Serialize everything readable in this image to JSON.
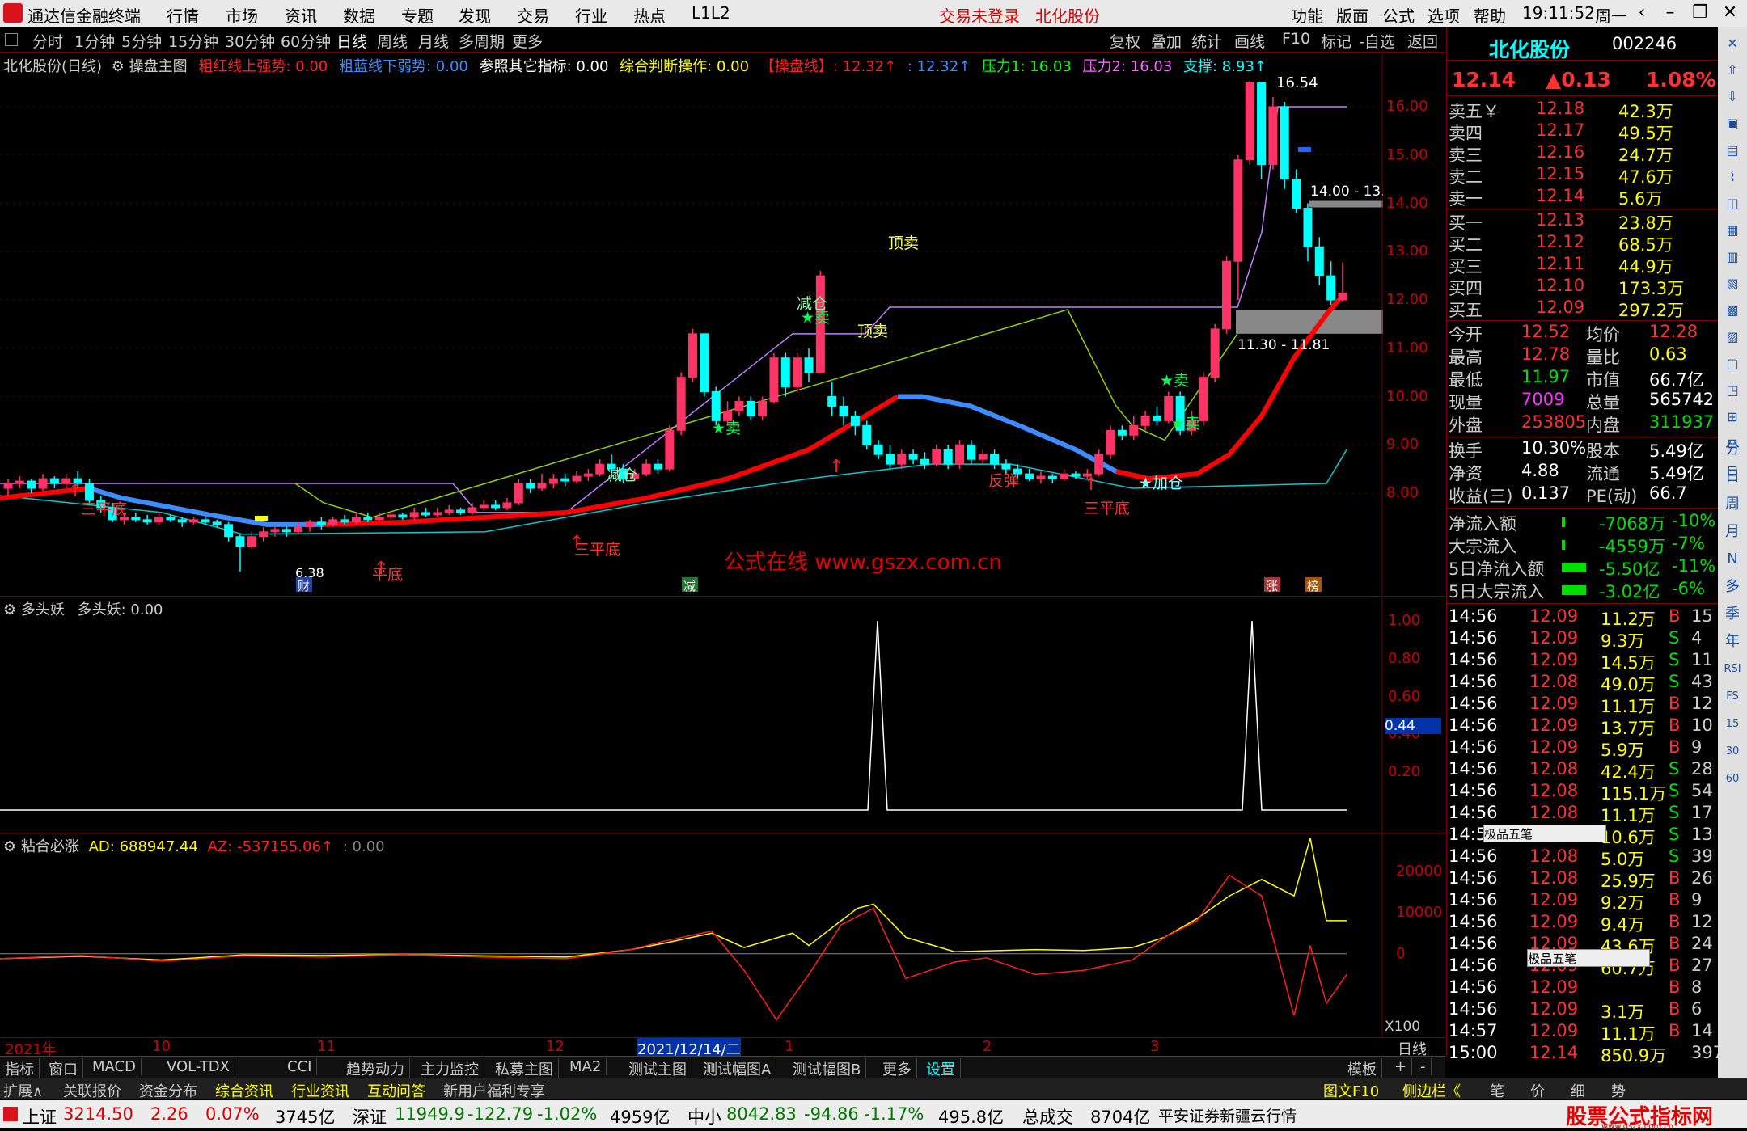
{
  "app": {
    "title": "通达信金融终端",
    "menu": [
      "行情",
      "市场",
      "资讯",
      "数据",
      "专题",
      "发现",
      "交易",
      "行业",
      "热点",
      "L1L2"
    ],
    "login_status": "交易未登录",
    "stock_name_top": "北化股份",
    "right_menu": [
      "功能",
      "版面",
      "公式",
      "选项",
      "帮助"
    ],
    "clock": "19:11:52",
    "weekday": "周一"
  },
  "periods": [
    "分时",
    "1分钟",
    "5分钟",
    "15分钟",
    "30分钟",
    "60分钟",
    "日线",
    "周线",
    "月线",
    "多周期",
    "更多"
  ],
  "selected_period": "日线",
  "chart_tools": [
    "复权",
    "叠加",
    "统计",
    "画线",
    "F10",
    "标记",
    "-自选",
    "返回"
  ],
  "main_legend": {
    "stock": "北化股份(日线)",
    "indicator": "操盘主图",
    "items": [
      {
        "text": "粗红线上强势: 0.00",
        "color": "#ff2020"
      },
      {
        "text": "粗蓝线下弱势: 0.00",
        "color": "#3d8cff"
      },
      {
        "text": "参照其它指标: 0.00",
        "color": "#ffffff"
      },
      {
        "text": "综合判断操作: 0.00",
        "color": "#ffff00"
      },
      {
        "text": "【操盘线】: 12.32↑",
        "color": "#ff2020"
      },
      {
        "text": ": 12.32↑",
        "color": "#3d8cff"
      },
      {
        "text": "压力1: 16.03",
        "color": "#00ff00"
      },
      {
        "text": "压力2: 16.03",
        "color": "#ff66ff"
      },
      {
        "text": "支撑: 8.93↑",
        "color": "#00ffff"
      }
    ]
  },
  "main_yticks": [
    "16.00",
    "15.00",
    "14.00",
    "13.00",
    "12.00",
    "11.00",
    "10.00",
    "9.00",
    "8.00"
  ],
  "main_annotations": {
    "high_label": "16.54",
    "low_label": "6.38",
    "zone_upper": "14.00 - 13.",
    "zone_lower": "11.30 - 11.81",
    "watermark": "公式在线  www.gszx.com.cn",
    "signals": [
      "三平底",
      "平底",
      "三平底",
      "顶卖",
      "顶卖",
      "减仓",
      "★卖",
      "★卖",
      "减仓",
      "★卖",
      "反弹",
      "三平底",
      "★加仓",
      "★卖"
    ],
    "markers": [
      "财",
      "减",
      "涨",
      "榜"
    ]
  },
  "vol_legend": {
    "name": "多头妖",
    "value": "多头妖: 0.00"
  },
  "vol_yticks": [
    "1.00",
    "0.80",
    "0.60",
    "0.40",
    "0.20"
  ],
  "vol_cursor": "0.44",
  "ad_legend": {
    "name": "粘合必涨",
    "ad": "AD: 688947.44",
    "az": "AZ: -537155.06↑",
    "extra": ": 0.00"
  },
  "ad_yticks": [
    "20000",
    "10000",
    "0"
  ],
  "ad_scale": "X100",
  "dates": [
    "2021年",
    "10",
    "11",
    "12",
    "2021/12/14/二",
    "1",
    "2",
    "3"
  ],
  "period_label": "日线",
  "bottom_tabs": [
    "指标",
    "窗口",
    "MACD",
    "VOL-TDX",
    "CCI",
    "趋势动力",
    "主力监控",
    "私募主图",
    "MA2",
    "测试主图",
    "测试幅图A",
    "测试幅图B",
    "更多",
    "设置"
  ],
  "bottom_tabs_right": [
    "模板",
    "+",
    "-"
  ],
  "bottom_tabs2": [
    {
      "text": "扩展∧",
      "color": "#ccc"
    },
    {
      "text": "关联报价",
      "color": "#ccc"
    },
    {
      "text": "资金分布",
      "color": "#ccc"
    },
    {
      "text": "综合资讯",
      "color": "#ffff00"
    },
    {
      "text": "行业资讯",
      "color": "#ffff00"
    },
    {
      "text": "互动问答",
      "color": "#ffff00"
    },
    {
      "text": "新用户福利专享",
      "color": "#ccc"
    }
  ],
  "bottom_tabs2_right": [
    "图文F10",
    "侧边栏《",
    "笔",
    "价",
    "细",
    "势"
  ],
  "status": {
    "sh_name": "上证",
    "sh_val": "3214.50",
    "sh_chg": "2.26",
    "sh_pct": "0.07%",
    "sh_amt": "3745亿",
    "sz_name": "深证",
    "sz_val": "11949.9",
    "sz_chg": "-122.79",
    "sz_pct": "-1.02%",
    "sz_amt": "4959亿",
    "zx_name": "中小",
    "zx_val": "8042.83",
    "zx_chg": "-94.86",
    "zx_pct": "-1.17%",
    "zx_amt": "495.8亿",
    "total_name": "总成交",
    "total_val": "8704亿",
    "broker": "平安证券新疆云行情",
    "logo_text": "股票公式指标网",
    "logo_url": "www.gszx.com.cn"
  },
  "quote": {
    "name": "北化股份",
    "code": "002246",
    "price": "12.14",
    "change": "▲0.13",
    "pct": "1.08%",
    "asks": [
      {
        "label": "卖五￥",
        "price": "12.18",
        "vol": "42.3万"
      },
      {
        "label": "卖四",
        "price": "12.17",
        "vol": "49.5万"
      },
      {
        "label": "卖三",
        "price": "12.16",
        "vol": "24.7万"
      },
      {
        "label": "卖二",
        "price": "12.15",
        "vol": "47.6万"
      },
      {
        "label": "卖一",
        "price": "12.14",
        "vol": "5.6万"
      }
    ],
    "bids": [
      {
        "label": "买一",
        "price": "12.13",
        "vol": "23.8万"
      },
      {
        "label": "买二",
        "price": "12.12",
        "vol": "68.5万"
      },
      {
        "label": "买三",
        "price": "12.11",
        "vol": "44.9万"
      },
      {
        "label": "买四",
        "price": "12.10",
        "vol": "173.3万"
      },
      {
        "label": "买五",
        "price": "12.09",
        "vol": "297.2万"
      }
    ],
    "stats": [
      {
        "l1": "今开",
        "v1": "12.52",
        "c1": "#ff3333",
        "l2": "均价",
        "v2": "12.28",
        "c2": "#ff3333"
      },
      {
        "l1": "最高",
        "v1": "12.78",
        "c1": "#ff3333",
        "l2": "量比",
        "v2": "0.63",
        "c2": "#ffff00"
      },
      {
        "l1": "最低",
        "v1": "11.97",
        "c1": "#00dd00",
        "l2": "市值",
        "v2": "66.7亿",
        "c2": "#ffffff"
      },
      {
        "l1": "现量",
        "v1": "7009",
        "c1": "#ff33ff",
        "l2": "总量",
        "v2": "565742",
        "c2": "#ffffff"
      },
      {
        "l1": "外盘",
        "v1": "253805",
        "c1": "#ff3333",
        "l2": "内盘",
        "v2": "311937",
        "c2": "#00dd00"
      }
    ],
    "stats2": [
      {
        "l1": "换手",
        "v1": "10.30%",
        "l2": "股本",
        "v2": "5.49亿"
      },
      {
        "l1": "净资",
        "v1": "4.88",
        "l2": "流通",
        "v2": "5.49亿"
      },
      {
        "l1": "收益(三)",
        "v1": "0.137",
        "l2": "PE(动)",
        "v2": "66.7"
      }
    ],
    "flows": [
      {
        "label": "净流入额",
        "val": "-7068万",
        "pct": "-10%"
      },
      {
        "label": "大宗流入",
        "val": "-4559万",
        "pct": "-7%"
      },
      {
        "label": "5日净流入额",
        "val": "-5.50亿",
        "pct": "-11%"
      },
      {
        "label": "5日大宗流入",
        "val": "-3.02亿",
        "pct": "-6%"
      }
    ],
    "ticks": [
      {
        "t": "14:56",
        "p": "12.09",
        "v": "11.2万",
        "d": "B",
        "n": "15"
      },
      {
        "t": "14:56",
        "p": "12.09",
        "v": "9.3万",
        "d": "S",
        "n": "4"
      },
      {
        "t": "14:56",
        "p": "12.09",
        "v": "14.5万",
        "d": "S",
        "n": "11"
      },
      {
        "t": "14:56",
        "p": "12.08",
        "v": "49.0万",
        "d": "S",
        "n": "43"
      },
      {
        "t": "14:56",
        "p": "12.09",
        "v": "11.1万",
        "d": "B",
        "n": "12"
      },
      {
        "t": "14:56",
        "p": "12.09",
        "v": "13.7万",
        "d": "B",
        "n": "10"
      },
      {
        "t": "14:56",
        "p": "12.09",
        "v": "5.9万",
        "d": "B",
        "n": "9"
      },
      {
        "t": "14:56",
        "p": "12.08",
        "v": "42.4万",
        "d": "S",
        "n": "28"
      },
      {
        "t": "14:56",
        "p": "12.08",
        "v": "115.1万",
        "d": "S",
        "n": "54"
      },
      {
        "t": "14:56",
        "p": "12.08",
        "v": "11.1万",
        "d": "S",
        "n": "17"
      },
      {
        "t": "14:56",
        "p": "12.08",
        "v": "10.6万",
        "d": "S",
        "n": "13"
      },
      {
        "t": "14:56",
        "p": "12.08",
        "v": "5.0万",
        "d": "S",
        "n": "39"
      },
      {
        "t": "14:56",
        "p": "12.08",
        "v": "25.9万",
        "d": "B",
        "n": "26"
      },
      {
        "t": "14:56",
        "p": "12.09",
        "v": "9.2万",
        "d": "B",
        "n": "9"
      },
      {
        "t": "14:56",
        "p": "12.09",
        "v": "9.4万",
        "d": "B",
        "n": "12"
      },
      {
        "t": "14:56",
        "p": "12.09",
        "v": "43.6万",
        "d": "B",
        "n": "24"
      },
      {
        "t": "14:56",
        "p": "12.09",
        "v": "60.7万",
        "d": "B",
        "n": "27"
      },
      {
        "t": "14:56",
        "p": "12.09",
        "v": "",
        "d": "B",
        "n": "8"
      },
      {
        "t": "14:56",
        "p": "12.09",
        "v": "3.1万",
        "d": "B",
        "n": "6"
      },
      {
        "t": "14:57",
        "p": "12.09",
        "v": "11.1万",
        "d": "B",
        "n": "14"
      },
      {
        "t": "15:00",
        "p": "12.14",
        "v": "850.9万",
        "d": "",
        "n": "397"
      }
    ],
    "ime_label": "极品五笔"
  },
  "side_tools": [
    "分",
    "日",
    "周",
    "月",
    "N",
    "多",
    "季",
    "年",
    "RSI",
    "FS",
    "15",
    "30",
    "60"
  ],
  "chart_data": {
    "type": "candlestick",
    "price_axis": [
      8.0,
      16.0
    ],
    "candles": [
      [
        8.1,
        8.2,
        7.95,
        8.3
      ],
      [
        8.2,
        8.25,
        8.1,
        8.35
      ],
      [
        8.25,
        8.1,
        8.0,
        8.3
      ],
      [
        8.1,
        8.3,
        8.05,
        8.4
      ],
      [
        8.3,
        8.2,
        8.1,
        8.35
      ],
      [
        8.2,
        8.3,
        8.1,
        8.4
      ],
      [
        8.3,
        8.2,
        8.1,
        8.45
      ],
      [
        8.2,
        7.85,
        7.8,
        8.3
      ],
      [
        7.85,
        7.7,
        7.6,
        7.95
      ],
      [
        7.7,
        7.45,
        7.4,
        7.8
      ],
      [
        7.45,
        7.5,
        7.35,
        7.6
      ],
      [
        7.5,
        7.45,
        7.4,
        7.6
      ],
      [
        7.45,
        7.4,
        7.35,
        7.55
      ],
      [
        7.4,
        7.5,
        7.35,
        7.6
      ],
      [
        7.5,
        7.45,
        7.4,
        7.55
      ],
      [
        7.45,
        7.4,
        7.3,
        7.5
      ],
      [
        7.4,
        7.45,
        7.35,
        7.5
      ],
      [
        7.45,
        7.4,
        7.35,
        7.5
      ],
      [
        7.4,
        7.35,
        7.3,
        7.45
      ],
      [
        7.35,
        7.1,
        7.0,
        7.4
      ],
      [
        7.1,
        6.9,
        6.38,
        7.15
      ],
      [
        6.9,
        7.1,
        6.85,
        7.2
      ],
      [
        7.1,
        7.2,
        7.0,
        7.3
      ],
      [
        7.2,
        7.25,
        7.1,
        7.3
      ],
      [
        7.25,
        7.2,
        7.1,
        7.3
      ],
      [
        7.2,
        7.3,
        7.15,
        7.4
      ],
      [
        7.3,
        7.4,
        7.2,
        7.45
      ],
      [
        7.4,
        7.35,
        7.25,
        7.5
      ],
      [
        7.35,
        7.45,
        7.3,
        7.5
      ],
      [
        7.45,
        7.4,
        7.35,
        7.55
      ],
      [
        7.4,
        7.5,
        7.35,
        7.6
      ],
      [
        7.5,
        7.45,
        7.4,
        7.6
      ],
      [
        7.45,
        7.5,
        7.4,
        7.6
      ],
      [
        7.5,
        7.55,
        7.45,
        7.6
      ],
      [
        7.55,
        7.5,
        7.45,
        7.6
      ],
      [
        7.5,
        7.6,
        7.45,
        7.7
      ],
      [
        7.6,
        7.55,
        7.5,
        7.7
      ],
      [
        7.55,
        7.6,
        7.5,
        7.7
      ],
      [
        7.6,
        7.65,
        7.55,
        7.75
      ],
      [
        7.65,
        7.6,
        7.55,
        7.7
      ],
      [
        7.6,
        7.7,
        7.55,
        7.8
      ],
      [
        7.7,
        7.75,
        7.65,
        7.85
      ],
      [
        7.75,
        7.7,
        7.65,
        7.85
      ],
      [
        7.7,
        7.8,
        7.65,
        7.9
      ],
      [
        7.8,
        8.2,
        7.75,
        8.3
      ],
      [
        8.2,
        8.1,
        8.0,
        8.3
      ],
      [
        8.1,
        8.2,
        8.05,
        8.4
      ],
      [
        8.2,
        8.3,
        8.1,
        8.4
      ],
      [
        8.3,
        8.25,
        8.15,
        8.4
      ],
      [
        8.25,
        8.35,
        8.2,
        8.45
      ],
      [
        8.35,
        8.4,
        8.25,
        8.5
      ],
      [
        8.4,
        8.6,
        8.35,
        8.7
      ],
      [
        8.6,
        8.5,
        8.4,
        8.8
      ],
      [
        8.5,
        8.3,
        8.2,
        8.6
      ],
      [
        8.3,
        8.4,
        8.25,
        8.5
      ],
      [
        8.4,
        8.6,
        8.35,
        8.7
      ],
      [
        8.6,
        8.5,
        8.4,
        8.7
      ],
      [
        8.5,
        9.3,
        8.45,
        9.4
      ],
      [
        9.3,
        10.4,
        9.2,
        10.5
      ],
      [
        10.4,
        11.3,
        10.3,
        11.4
      ],
      [
        11.3,
        10.1,
        10.0,
        11.3
      ],
      [
        10.1,
        9.5,
        9.4,
        10.2
      ],
      [
        9.5,
        9.7,
        9.4,
        9.9
      ],
      [
        9.7,
        9.9,
        9.6,
        10.0
      ],
      [
        9.9,
        9.6,
        9.5,
        10.0
      ],
      [
        9.6,
        9.9,
        9.5,
        10.0
      ],
      [
        9.9,
        10.8,
        9.85,
        10.9
      ],
      [
        10.8,
        10.2,
        10.0,
        10.9
      ],
      [
        10.2,
        10.8,
        10.1,
        10.9
      ],
      [
        10.8,
        10.5,
        10.3,
        11.0
      ],
      [
        10.5,
        12.5,
        10.5,
        12.6
      ],
      [
        10.0,
        9.8,
        9.6,
        10.3
      ],
      [
        9.8,
        9.6,
        9.4,
        10.0
      ],
      [
        9.6,
        9.4,
        9.2,
        9.7
      ],
      [
        9.4,
        9.0,
        8.9,
        9.5
      ],
      [
        9.0,
        8.8,
        8.7,
        9.1
      ],
      [
        8.8,
        8.6,
        8.5,
        9.0
      ],
      [
        8.6,
        8.8,
        8.5,
        8.9
      ],
      [
        8.8,
        8.7,
        8.6,
        8.9
      ],
      [
        8.7,
        8.6,
        8.5,
        8.85
      ],
      [
        8.6,
        8.9,
        8.55,
        9.0
      ],
      [
        8.9,
        8.6,
        8.5,
        9.0
      ],
      [
        8.6,
        9.0,
        8.5,
        9.1
      ],
      [
        9.0,
        8.7,
        8.6,
        9.1
      ],
      [
        8.7,
        8.8,
        8.6,
        8.9
      ],
      [
        8.8,
        8.6,
        8.5,
        8.9
      ],
      [
        8.6,
        8.5,
        8.4,
        8.7
      ],
      [
        8.5,
        8.4,
        8.3,
        8.6
      ],
      [
        8.4,
        8.3,
        8.25,
        8.5
      ],
      [
        8.3,
        8.35,
        8.2,
        8.45
      ],
      [
        8.35,
        8.3,
        8.2,
        8.4
      ],
      [
        8.3,
        8.4,
        8.25,
        8.5
      ],
      [
        8.4,
        8.35,
        8.3,
        8.45
      ],
      [
        8.35,
        8.4,
        8.3,
        8.5
      ],
      [
        8.4,
        8.8,
        8.35,
        8.9
      ],
      [
        8.8,
        9.3,
        8.7,
        9.4
      ],
      [
        9.3,
        9.2,
        9.1,
        9.4
      ],
      [
        9.2,
        9.4,
        9.1,
        9.6
      ],
      [
        9.4,
        9.6,
        9.3,
        9.7
      ],
      [
        9.6,
        9.5,
        9.4,
        9.8
      ],
      [
        9.5,
        10.0,
        9.45,
        10.1
      ],
      [
        10.0,
        9.3,
        9.2,
        10.1
      ],
      [
        9.3,
        9.5,
        9.2,
        9.7
      ],
      [
        9.5,
        10.4,
        9.4,
        10.5
      ],
      [
        10.4,
        11.4,
        10.3,
        11.5
      ],
      [
        11.4,
        12.8,
        11.3,
        12.9
      ],
      [
        12.8,
        14.9,
        12.0,
        15.0
      ],
      [
        14.9,
        16.5,
        14.8,
        16.54
      ],
      [
        16.5,
        14.8,
        14.5,
        16.0
      ],
      [
        14.8,
        16.0,
        14.7,
        16.2
      ],
      [
        16.0,
        14.5,
        14.3,
        16.1
      ],
      [
        14.5,
        13.9,
        13.8,
        14.7
      ],
      [
        13.9,
        13.1,
        12.8,
        14.0
      ],
      [
        13.1,
        12.5,
        12.3,
        13.3
      ],
      [
        12.5,
        12.0,
        11.9,
        12.8
      ],
      [
        12.0,
        12.14,
        11.97,
        12.78
      ]
    ],
    "vol_spikes": [
      1.0,
      1.0
    ],
    "ad_yrange": [
      -20000,
      25000
    ]
  },
  "colors": {
    "up": "#ff3366",
    "down": "#00ffff",
    "ma_red": "#ff0000",
    "ma_blue": "#3d8cff",
    "grid": "#7a0000"
  }
}
